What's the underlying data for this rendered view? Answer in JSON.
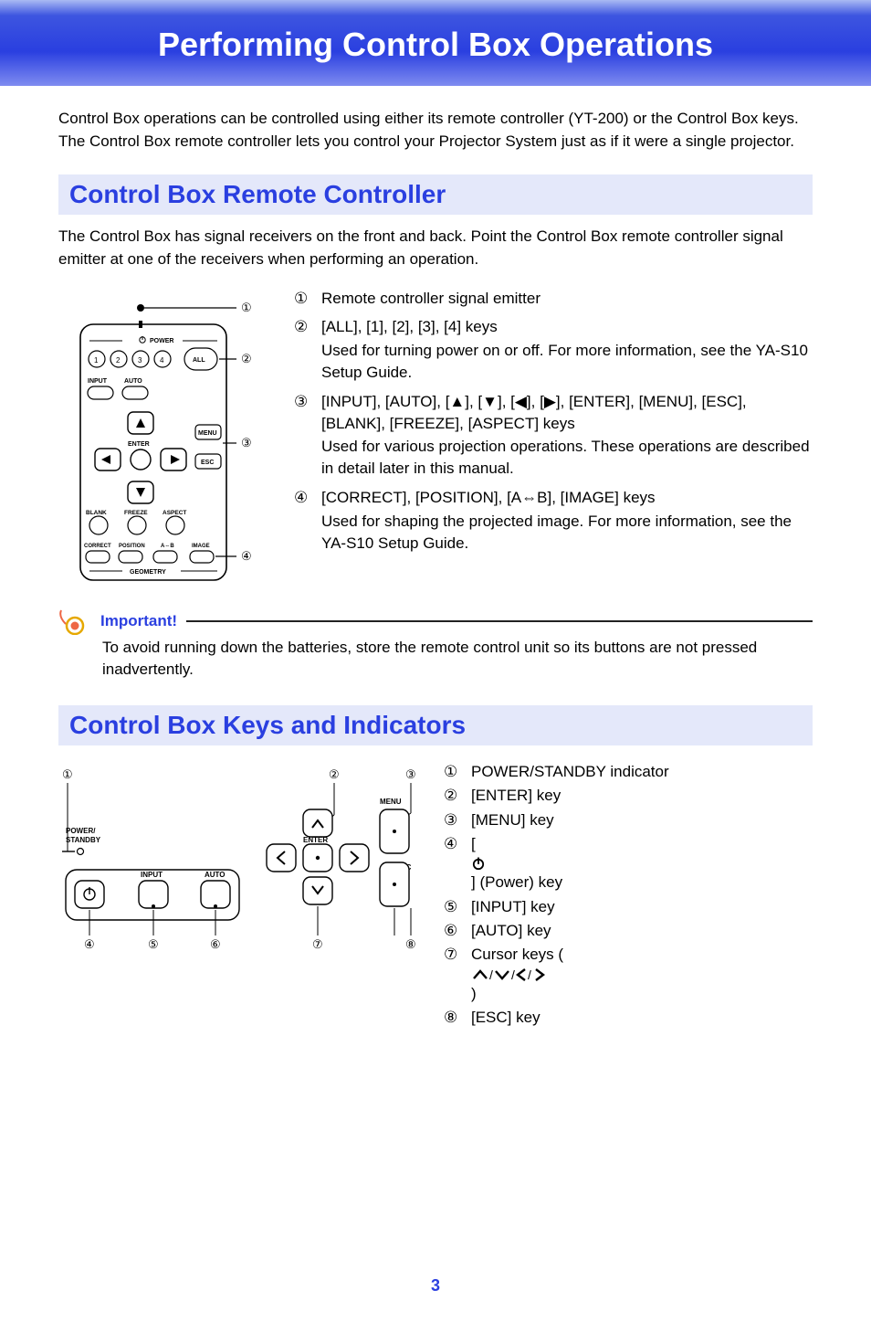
{
  "page_title": "Performing Control Box Operations",
  "intro_paragraph": "Control Box operations can be controlled using either its remote controller (YT-200) or the Control Box keys. The Control Box remote controller lets you control your Projector System just as if it were a single projector.",
  "section_remote": {
    "heading": "Control Box Remote Controller",
    "paragraph": "The Control Box has signal receivers on the front and back. Point the Control Box remote controller signal emitter at one of the receivers when performing an operation.",
    "callouts": [
      {
        "num": "①",
        "title": "Remote controller signal emitter",
        "desc": ""
      },
      {
        "num": "②",
        "title": "[ALL], [1], [2], [3], [4] keys",
        "desc": "Used for turning power on or off. For more information, see the YA-S10 Setup Guide."
      },
      {
        "num": "③",
        "title": "[INPUT], [AUTO], [▲], [▼], [◀], [▶], [ENTER], [MENU], [ESC], [BLANK], [FREEZE], [ASPECT] keys",
        "desc": "Used for various projection operations. These operations are described in detail later in this manual."
      },
      {
        "num": "④",
        "title": "[CORRECT], [POSITION], [A⇔B], [IMAGE] keys",
        "desc": "Used for shaping the projected image. For more information, see the YA-S10 Setup Guide."
      }
    ]
  },
  "important": {
    "label": "Important!",
    "text": "To avoid running down the batteries, store the remote control unit so its buttons are not pressed inadvertently."
  },
  "section_keys": {
    "heading": "Control Box Keys and Indicators",
    "callouts": [
      {
        "num": "①",
        "text": "POWER/STANDBY indicator"
      },
      {
        "num": "②",
        "text": "[ENTER] key"
      },
      {
        "num": "③",
        "text": "[MENU] key"
      },
      {
        "num": "④",
        "text_prefix": "[",
        "text_suffix": "] (Power) key"
      },
      {
        "num": "⑤",
        "text": "[INPUT] key"
      },
      {
        "num": "⑥",
        "text": "[AUTO] key"
      },
      {
        "num": "⑦",
        "text_prefix": "Cursor keys (",
        "text_suffix": ")"
      },
      {
        "num": "⑧",
        "text": "[ESC] key"
      }
    ]
  },
  "remote_diagram_labels": {
    "power": "POWER",
    "all": "ALL",
    "n1": "1",
    "n2": "2",
    "n3": "3",
    "n4": "4",
    "input": "INPUT",
    "auto": "AUTO",
    "menu": "MENU",
    "enter": "ENTER",
    "esc": "ESC",
    "blank": "BLANK",
    "freeze": "FREEZE",
    "aspect": "ASPECT",
    "correct": "CORRECT",
    "position": "POSITION",
    "ab": "A⇔B",
    "image": "IMAGE",
    "geometry": "GEOMETRY",
    "cnum1": "①",
    "cnum2": "②",
    "cnum3": "③",
    "cnum4": "④"
  },
  "keys_diagram_labels": {
    "power_standby": "POWER/\nSTANDBY",
    "input": "INPUT",
    "auto": "AUTO",
    "menu": "MENU",
    "enter": "ENTER",
    "esc": "ESC",
    "cnum1": "①",
    "cnum2": "②",
    "cnum3": "③",
    "cnum4": "④",
    "cnum5": "⑤",
    "cnum6": "⑥",
    "cnum7": "⑦",
    "cnum8": "⑧"
  },
  "page_number": "3"
}
